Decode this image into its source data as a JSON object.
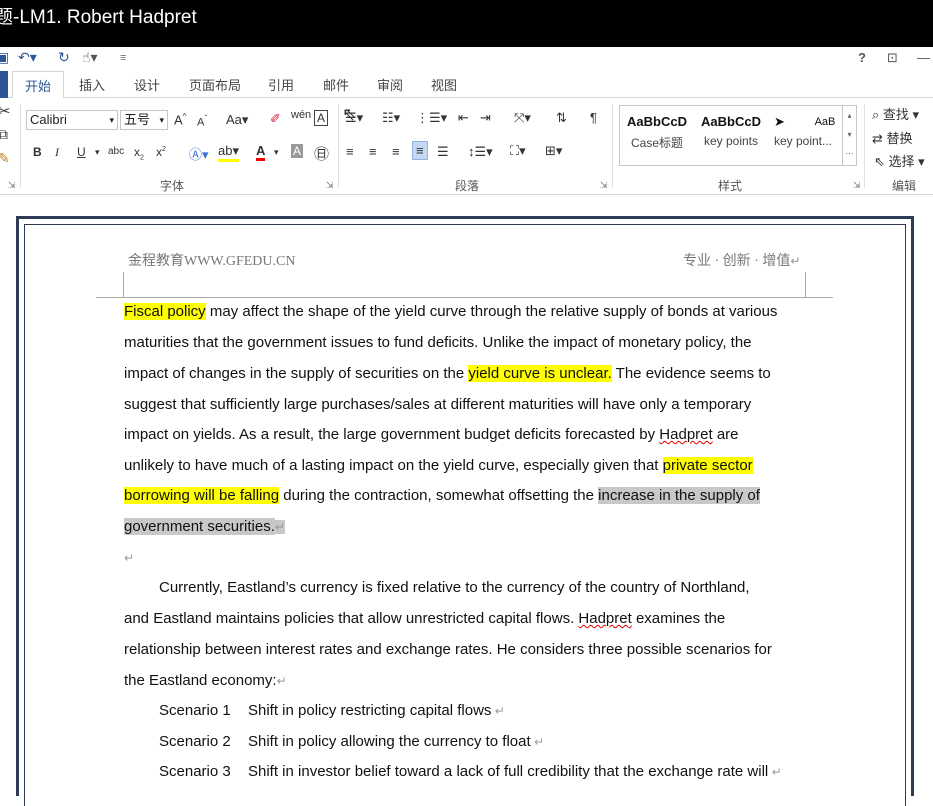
{
  "window": {
    "title": "题-LM1. Robert Hadpret"
  },
  "qat": {
    "help": "?",
    "restore": "⊡",
    "minimize": "—"
  },
  "tabs": [
    {
      "label": "开始",
      "active": true
    },
    {
      "label": "插入"
    },
    {
      "label": "设计"
    },
    {
      "label": "页面布局"
    },
    {
      "label": "引用"
    },
    {
      "label": "邮件"
    },
    {
      "label": "审阅"
    },
    {
      "label": "视图"
    }
  ],
  "ribbon": {
    "font_name": "Calibri",
    "font_size": "五号",
    "font_group": "字体",
    "paragraph_group": "段落",
    "styles_group": "样式",
    "editing_group": "编辑",
    "styles": [
      {
        "preview": "AaBbCcD",
        "name": "Case标题"
      },
      {
        "preview": "AaBbCcD",
        "name": "key points"
      },
      {
        "preview": "➤",
        "name": "key point..."
      },
      {
        "preview": "AaB",
        "name": ""
      }
    ],
    "find": "查找",
    "replace": "替换",
    "select": "选择"
  },
  "page": {
    "header_left": "金程教育WWW.GFEDU.CN",
    "header_right": "专业 · 创新 · 增值",
    "p1": {
      "l1_hl": "Fiscal policy",
      "l1": " may affect the shape of the yield curve through the relative supply of bonds at various",
      "l2": "maturities that the government issues to fund deficits. Unlike the impact of monetary policy, the",
      "l3a": "impact of changes in the supply of securities on the ",
      "l3_hl": "yield curve is unclear.",
      "l3b": " The evidence seems to",
      "l4": "suggest that sufficiently large purchases/sales at different maturities will have only a temporary",
      "l5a": "impact on yields. As a result, the large government budget deficits forecasted by ",
      "l5_name": "Hadpret",
      "l5b": " are",
      "l6a": "unlikely to have much of a lasting impact on the yield curve, especially given that ",
      "l6_hl": "private sector",
      "l7_hl": "borrowing will be falling",
      "l7a": " during the contraction, somewhat offsetting the ",
      "l7_hl2": "increase in the supply of",
      "l8_hl2": "government securities."
    },
    "p2": {
      "l1": "Currently, Eastland’s currency is fixed relative to the currency of the country of Northland,",
      "l2a": "and Eastland maintains policies that allow unrestricted capital flows. ",
      "l2_name": "Hadpret",
      "l2b": " examines the",
      "l3": "relationship between interest rates and exchange rates. He considers three possible scenarios for",
      "l4": "the Eastland economy:"
    },
    "scenarios": [
      {
        "label": "Scenario 1",
        "text": "Shift in policy restricting capital flows"
      },
      {
        "label": "Scenario 2",
        "text": "Shift in policy allowing the currency to float"
      },
      {
        "label": "Scenario 3",
        "text": "Shift in investor belief toward a lack of full credibility that the exchange rate will"
      }
    ]
  }
}
